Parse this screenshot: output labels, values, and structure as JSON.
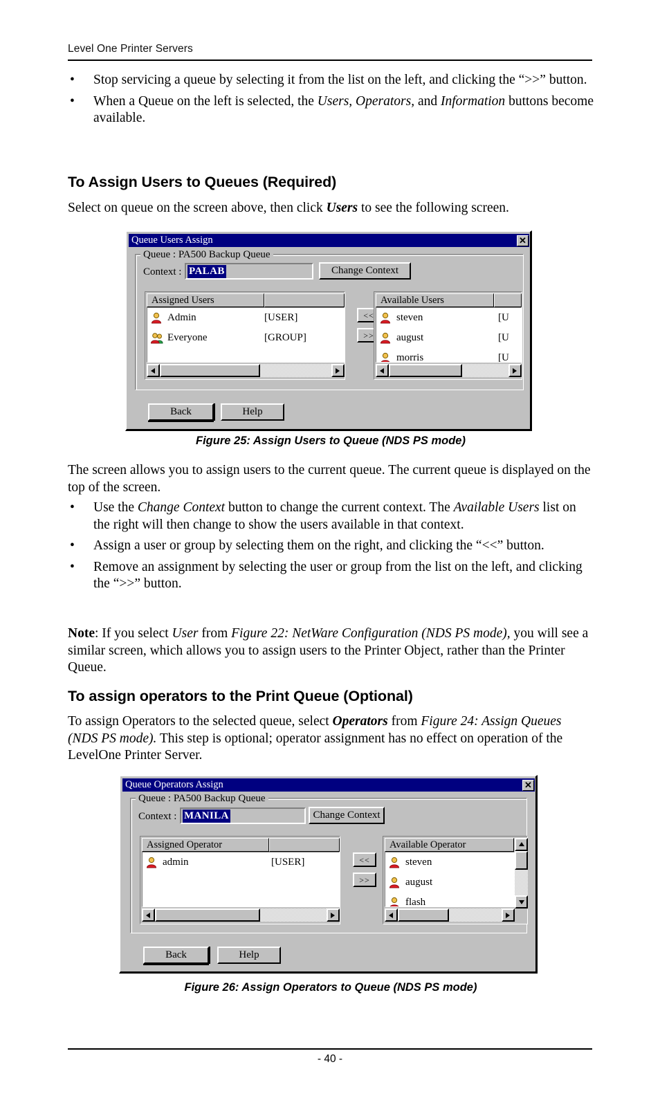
{
  "page": {
    "running_head": "Level One Printer Servers",
    "page_number": "- 40 -"
  },
  "intro_bullets": [
    "Stop servicing a queue by selecting it from the list on the left, and clicking the “>>” button.",
    "When a Queue on the left is selected, the Users, Operators, and Information buttons become available."
  ],
  "section1": {
    "heading": "To Assign Users to Queues (Required)",
    "intro": "Select on queue on the screen above, then click Users to see the following screen."
  },
  "figure25": {
    "caption": "Figure 25: Assign Users to Queue (NDS PS mode)",
    "title": "Queue Users Assign",
    "close_label": "✕",
    "group_legend": "Queue : PA500 Backup Queue",
    "context_label": "Context :",
    "context_value": "PALAB",
    "change_context_label": "Change Context",
    "left_list": {
      "header": "Assigned Users",
      "header2": "",
      "rows": [
        {
          "icon": "user-icon",
          "name": "Admin",
          "type": "[USER]"
        },
        {
          "icon": "group-icon",
          "name": "Everyone",
          "type": "[GROUP]"
        }
      ]
    },
    "right_list": {
      "header": "Available Users",
      "header2": "",
      "rows": [
        {
          "icon": "user-icon",
          "name": "steven",
          "type": "[U"
        },
        {
          "icon": "user-icon",
          "name": "august",
          "type": "[U"
        },
        {
          "icon": "user-icon",
          "name": "morris",
          "type": "[U"
        }
      ]
    },
    "move_left_label": "<<",
    "move_right_label": ">>",
    "back_label": "Back",
    "help_label": "Help"
  },
  "after_fig25": {
    "para": "The screen allows you to assign users to the current queue. The current queue is displayed on the top of the screen.",
    "bullets": [
      "Use the Change Context button to change the current context. The Available Users list on the right will then change to show the users available in that context.",
      "Assign a user or group by selecting them on the right, and clicking the “<<” button.",
      "Remove an assignment by selecting the user or group from the list on the left, and clicking the “>>” button."
    ],
    "note": "Note: If you select User from Figure 22: NetWare Configuration (NDS PS mode), you will see a similar screen, which allows you to assign users to the Printer Object, rather than the Printer Queue."
  },
  "section2": {
    "heading": "To assign operators to the Print Queue (Optional)",
    "intro": "To assign Operators to the selected queue, select Operators from Figure 24: Assign Queues (NDS PS mode). This step is optional; operator assignment has no effect on operation of the LevelOne Printer Server."
  },
  "figure26": {
    "caption": "Figure 26: Assign Operators to Queue (NDS PS mode)",
    "title": "Queue Operators Assign",
    "close_label": "✕",
    "group_legend": "Queue : PA500 Backup Queue",
    "context_label": "Context :",
    "context_value": "MANILA",
    "change_context_label": "Change Context",
    "left_list": {
      "header": "Assigned Operator",
      "header2": "",
      "rows": [
        {
          "icon": "user-icon",
          "name": "admin",
          "type": "[USER]"
        }
      ]
    },
    "right_list": {
      "header": "Available Operator",
      "header2": "",
      "rows": [
        {
          "icon": "user-icon",
          "name": "steven",
          "type": ""
        },
        {
          "icon": "user-icon",
          "name": "august",
          "type": ""
        },
        {
          "icon": "user-icon",
          "name": "flash",
          "type": ""
        }
      ]
    },
    "move_left_label": "<<",
    "move_right_label": ">>",
    "back_label": "Back",
    "help_label": "Help"
  },
  "colors": {
    "titlebar": "#000080",
    "dialog_face": "#c0c0c0",
    "selection": "#000080",
    "icon_body": "#e01b24",
    "icon_head": "#f2c14e",
    "group_green": "#2aa84a"
  }
}
